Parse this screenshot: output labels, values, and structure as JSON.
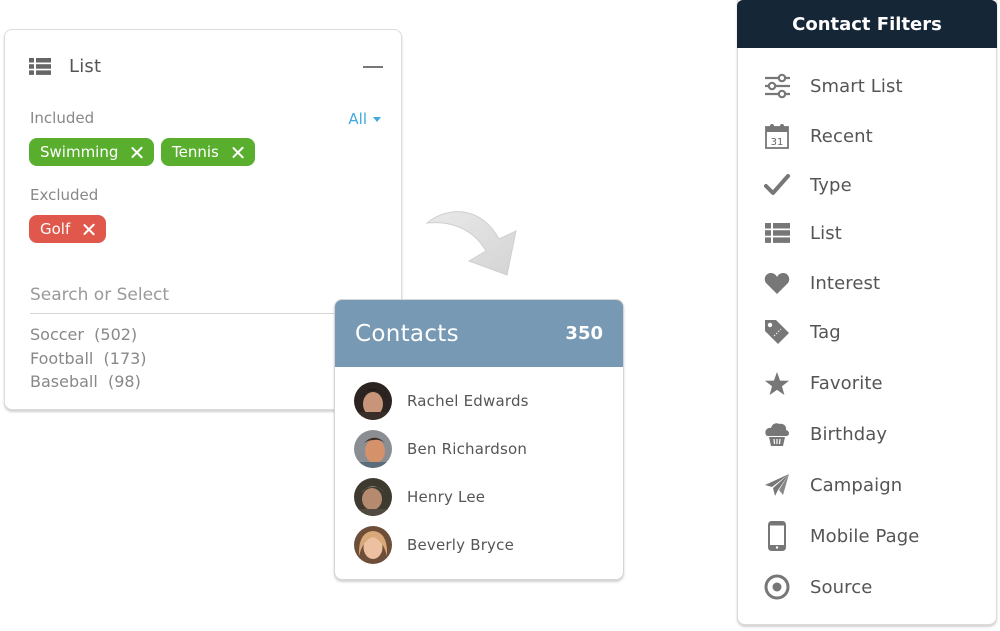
{
  "list_panel": {
    "title": "List",
    "icon": "list-icon",
    "collapse_icon": "minus-icon",
    "included_label": "Included",
    "included_mode": "All",
    "included": [
      {
        "label": "Swimming",
        "color": "#5aae2e"
      },
      {
        "label": "Tennis",
        "color": "#5aae2e"
      }
    ],
    "excluded_label": "Excluded",
    "excluded": [
      {
        "label": "Golf",
        "color": "#e0574b"
      }
    ],
    "search_placeholder": "Search or Select",
    "options": [
      {
        "name": "Soccer",
        "count": "(502)"
      },
      {
        "name": "Football",
        "count": "(173)"
      },
      {
        "name": "Baseball",
        "count": "(98)"
      }
    ]
  },
  "contacts_panel": {
    "title": "Contacts",
    "count": "350",
    "header_color": "#7799b4",
    "contacts": [
      {
        "name": "Rachel Edwards"
      },
      {
        "name": "Ben Richardson"
      },
      {
        "name": "Henry Lee"
      },
      {
        "name": "Beverly Bryce"
      }
    ]
  },
  "filters_panel": {
    "title": "Contact Filters",
    "header_color": "#152636",
    "items": [
      {
        "label": "Smart List",
        "icon": "sliders-icon"
      },
      {
        "label": "Recent",
        "icon": "calendar-icon",
        "icon_text": "31"
      },
      {
        "label": "Type",
        "icon": "check-icon"
      },
      {
        "label": "List",
        "icon": "list-icon"
      },
      {
        "label": "Interest",
        "icon": "heart-icon"
      },
      {
        "label": "Tag",
        "icon": "tag-icon"
      },
      {
        "label": "Favorite",
        "icon": "star-icon"
      },
      {
        "label": "Birthday",
        "icon": "cupcake-icon"
      },
      {
        "label": "Campaign",
        "icon": "paper-plane-icon"
      },
      {
        "label": "Mobile Page",
        "icon": "mobile-icon"
      },
      {
        "label": "Source",
        "icon": "target-icon"
      }
    ]
  }
}
